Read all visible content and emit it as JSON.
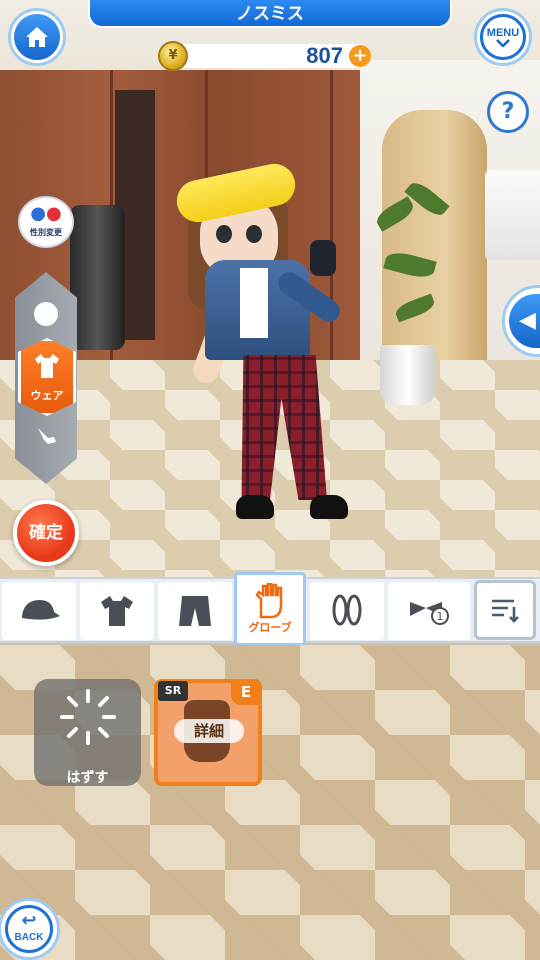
{
  "header": {
    "title": "ノスミス",
    "home_icon": "home-icon",
    "menu_label": "MENU",
    "help_label": "?"
  },
  "currency": {
    "amount": "807",
    "plus_label": "+",
    "icon": "coin-icon"
  },
  "left_panel": {
    "gender_change_label": "性別変更",
    "categories": [
      {
        "icon": "face-icon"
      },
      {
        "icon": "shirt-icon",
        "label": "ウェア"
      },
      {
        "icon": "club-icon"
      }
    ],
    "confirm_label": "確定"
  },
  "tabs": [
    {
      "icon": "cap-icon"
    },
    {
      "icon": "shirt-icon"
    },
    {
      "icon": "pants-icon"
    },
    {
      "icon": "glove-icon",
      "label": "グローブ"
    },
    {
      "icon": "shoes-icon"
    },
    {
      "icon": "ribbon-icon"
    }
  ],
  "inventory": {
    "remove_label": "はずす",
    "items": [
      {
        "rarity": "SR",
        "equipped_badge": "E",
        "detail_label": "詳細"
      }
    ]
  },
  "footer": {
    "back_label": "BACK"
  },
  "colors": {
    "accent_blue": "#1566c9",
    "accent_orange": "#f06a12",
    "confirm_red": "#e8381a"
  }
}
